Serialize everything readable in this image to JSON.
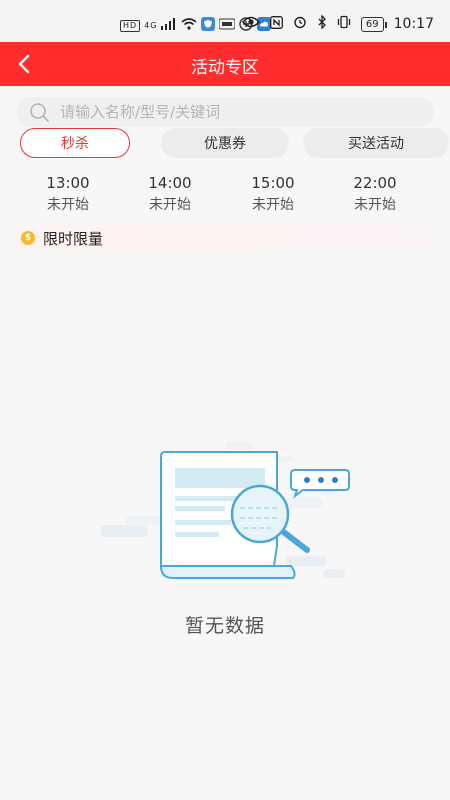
{
  "status_bar": {
    "network_labels": [
      "HD",
      "4G"
    ],
    "time": "10:17",
    "battery": "69",
    "icons": [
      "signal-icon",
      "wifi-icon",
      "shield-app-icon",
      "app-icon",
      "app-icon",
      "cloud-icon",
      "eye-icon",
      "nfc-icon",
      "alarm-icon",
      "bluetooth-icon",
      "vibrate-icon",
      "battery-icon"
    ]
  },
  "header": {
    "title": "活动专区",
    "back_icon": "chevron-left-icon",
    "color": "#ff2d2d"
  },
  "search": {
    "placeholder": "请输入名称/型号/关键词",
    "value": ""
  },
  "tabs": [
    {
      "label": "秒杀",
      "active": true
    },
    {
      "label": "优惠券",
      "active": false
    },
    {
      "label": "买送活动",
      "active": false
    }
  ],
  "time_slots": [
    {
      "time": "13:00",
      "status": "未开始"
    },
    {
      "time": "14:00",
      "status": "未开始"
    },
    {
      "time": "15:00",
      "status": "未开始"
    },
    {
      "time": "22:00",
      "status": "未开始"
    }
  ],
  "limit_banner": {
    "label": "限时限量",
    "icon": "coin-icon",
    "icon_char": "$"
  },
  "empty_state": {
    "message": "暂无数据",
    "illustration": "empty-document-magnifier-illustration"
  },
  "colors": {
    "accent": "#e0393a",
    "header_red": "#ff2d2d",
    "illustration_blue": "#4aa8d8"
  }
}
